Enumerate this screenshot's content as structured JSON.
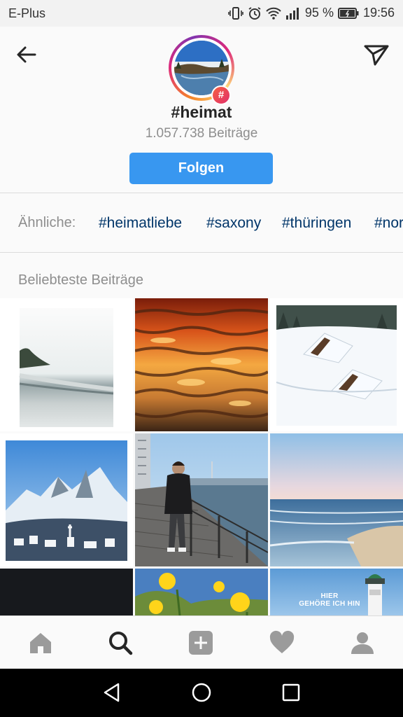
{
  "status_bar": {
    "carrier": "E-Plus",
    "battery": "95 %",
    "time": "19:56",
    "icons": [
      "vibrate-icon",
      "alarm-icon",
      "wifi-icon",
      "signal-icon",
      "battery-icon"
    ]
  },
  "header": {
    "hashtag": "#heimat",
    "post_count": "1.057.738 Beiträge",
    "follow_label": "Folgen",
    "badge": "#"
  },
  "related": {
    "label": "Ähnliche:",
    "tags": [
      "#heimatliebe",
      "#saxony",
      "#thüringen",
      "#nor"
    ]
  },
  "top_posts": {
    "title": "Beliebteste Beiträge",
    "overlay_text": [
      "HIER",
      "GEHÖRE ICH HIN"
    ]
  },
  "bottom_nav": [
    "home-icon",
    "search-icon",
    "add-post-icon",
    "activity-heart-icon",
    "profile-icon"
  ],
  "system_nav": [
    "back-triangle-icon",
    "home-circle-icon",
    "recents-square-icon"
  ],
  "colors": {
    "accent_blue": "#3897f0",
    "hashtag_link": "#003569",
    "secondary_text": "#8e8e8e"
  }
}
